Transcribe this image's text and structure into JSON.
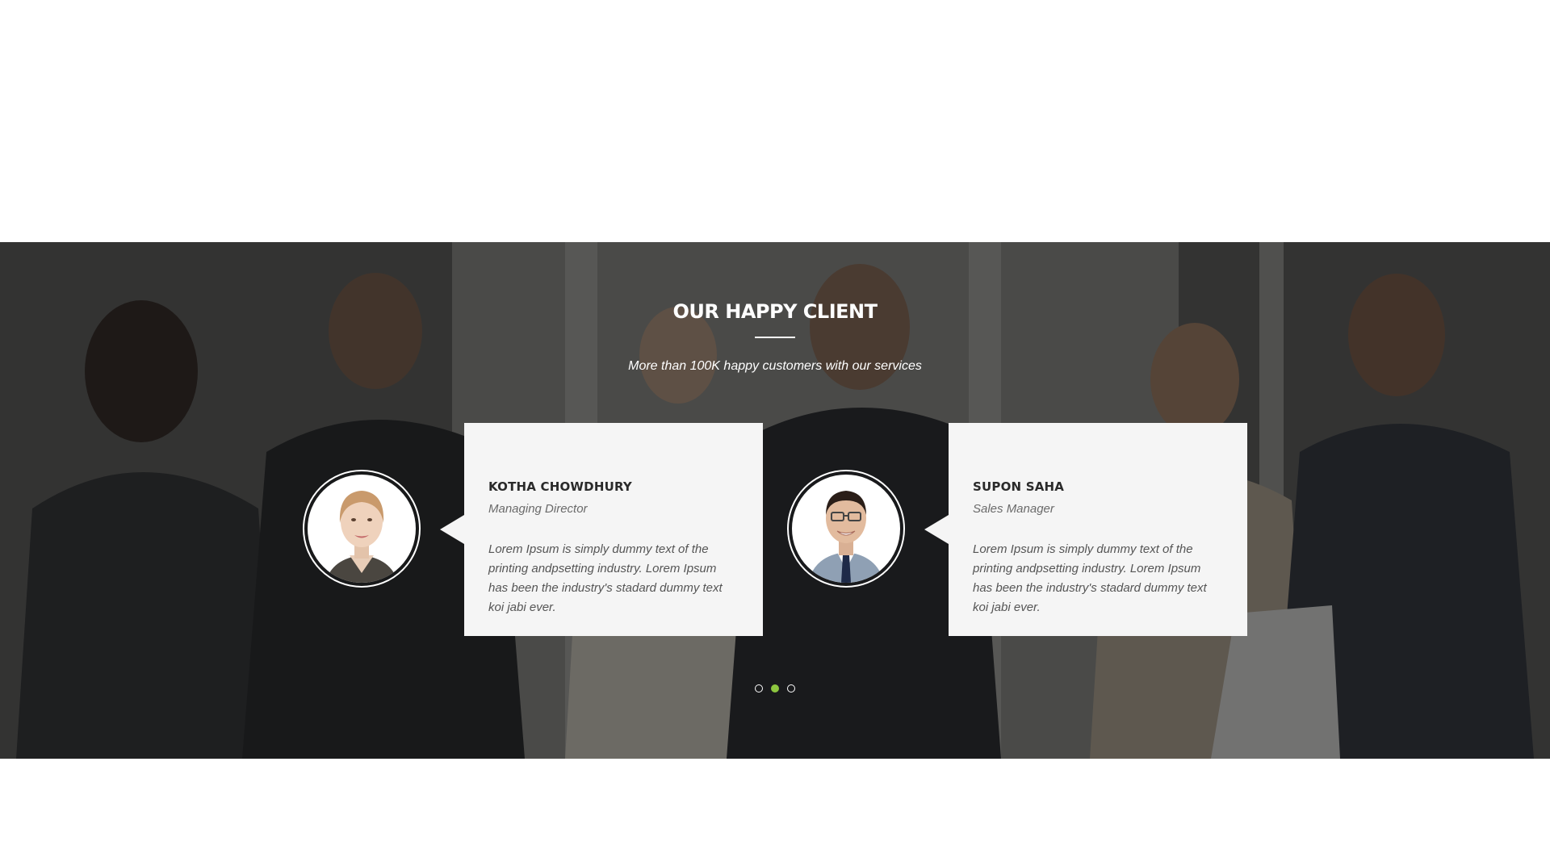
{
  "testimonials": {
    "title": "OUR HAPPY CLIENT",
    "subtitle": "More than 100K happy customers with our services",
    "clients": [
      {
        "name": "KOTHA CHOWDHURY",
        "role": "Managing Director",
        "quote": "Lorem Ipsum is simply dummy text of the printing andpsetting industry. Lorem Ipsum has been the industry's stadard dummy text koi jabi ever.",
        "avatar": "woman-portrait"
      },
      {
        "name": "SUPON SAHA",
        "role": "Sales Manager",
        "quote": "Lorem Ipsum is simply dummy text of the printing andpsetting industry. Lorem Ipsum has been the industry's stadard dummy text koi jabi ever.",
        "avatar": "man-portrait-glasses"
      }
    ],
    "pagination": {
      "total": 3,
      "active": 2
    },
    "colors": {
      "accent": "#8dc63f",
      "card": "#f5f5f5",
      "overlay": "#141414"
    }
  }
}
